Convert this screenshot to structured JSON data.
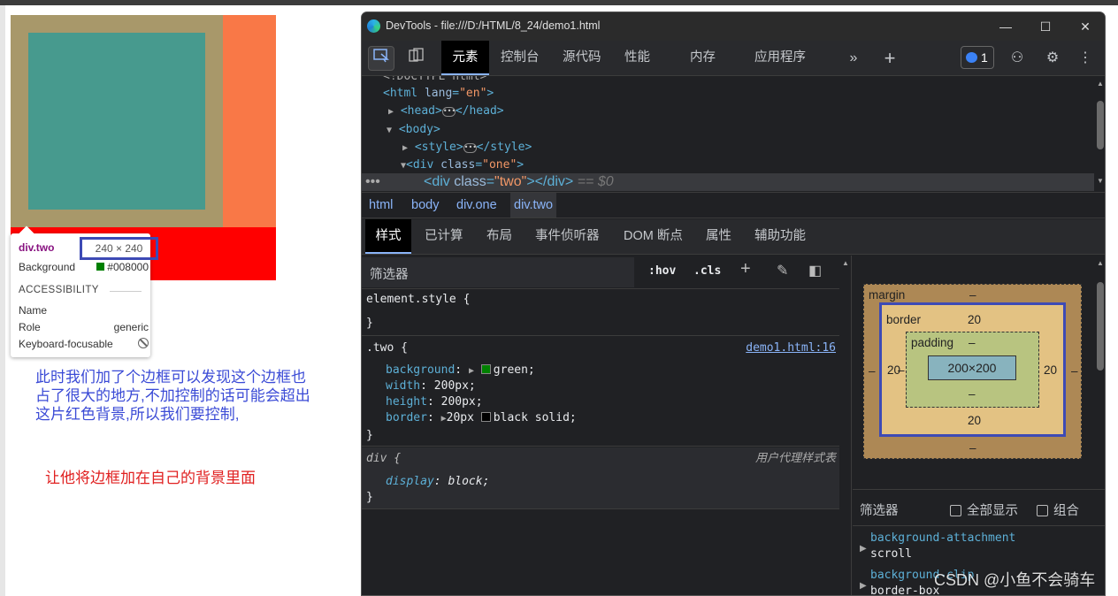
{
  "tooltip": {
    "selector": "div.two",
    "size": "240 × 240",
    "background_label": "Background",
    "background_value": "#008000",
    "accessibility_header": "ACCESSIBILITY",
    "name_label": "Name",
    "name_value": "",
    "role_label": "Role",
    "role_value": "generic",
    "keyboard_label": "Keyboard-focusable"
  },
  "notes": {
    "line1": "此时我们加了个边框可以发现这个边框也",
    "line2": "占了很大的地方,不加控制的话可能会超出",
    "line3": "这片红色背景,所以我们要控制,",
    "instruction": "让他将边框加在自己的背景里面"
  },
  "devtools": {
    "title": "DevTools - file:///D:/HTML/8_24/demo1.html",
    "window_controls": [
      "—",
      "☐",
      "✕"
    ],
    "tabs": [
      "元素",
      "控制台",
      "源代码",
      "性能",
      "内存",
      "应用程序"
    ],
    "active_tab": "元素",
    "issues_count": "1",
    "dom": {
      "line0": "<!DOCTYPE html>",
      "html_open": "<html",
      "html_attr": "lang",
      "html_attr_val": "\"en\"",
      "head": "<head>",
      "head_close": "</head>",
      "body": "<body>",
      "style": "<style>",
      "style_close": "</style>",
      "div_one": "<div",
      "div_one_attr": "class",
      "div_one_val": "\"one\"",
      "div_two": "<div",
      "div_two_attr": "class",
      "div_two_val": "\"two\"",
      "div_two_close": "></div>",
      "dollar": "== $0"
    },
    "breadcrumbs": [
      "html",
      "body",
      "div.one",
      "div.two"
    ],
    "subtabs": [
      "样式",
      "已计算",
      "布局",
      "事件侦听器",
      "DOM 断点",
      "属性",
      "辅助功能"
    ],
    "styles": {
      "filter_placeholder": "筛选器",
      "hov": ":hov",
      "cls": ".cls",
      "element_style": "element.style {",
      "close": "}",
      "rule_selector": ".two {",
      "rule_source": "demo1.html:16",
      "props": [
        {
          "name": "background",
          "value": "green;",
          "swatch": "#008000"
        },
        {
          "name": "width",
          "value": "200px;"
        },
        {
          "name": "height",
          "value": "200px;"
        },
        {
          "name": "border",
          "value": "20px",
          "value2": "black solid;",
          "swatch": "#000000"
        }
      ],
      "ua_selector": "div {",
      "ua_label": "用户代理样式表",
      "ua_prop": "display",
      "ua_value": "block;"
    },
    "boxmodel": {
      "margin_label": "margin",
      "margin_value": "–",
      "border_label": "border",
      "border_top": "20",
      "border_left": "20",
      "border_right": "20",
      "border_bottom": "20",
      "padding_label": "padding",
      "padding_value": "–",
      "content": "200×200",
      "dash": "–"
    },
    "computed": {
      "filter": "筛选器",
      "show_all": "全部显示",
      "group": "组合",
      "props": [
        {
          "name": "background-attachment",
          "value": "scroll"
        },
        {
          "name": "background-clip",
          "value": "border-box"
        }
      ]
    }
  },
  "watermark": "CSDN @小鱼不会骑车",
  "colors": {
    "red_bg": "#ff0000",
    "orange": "#f97847",
    "border_brown": "#a8986a",
    "teal": "#479a8e",
    "accent_blue": "#8ab4f8"
  }
}
